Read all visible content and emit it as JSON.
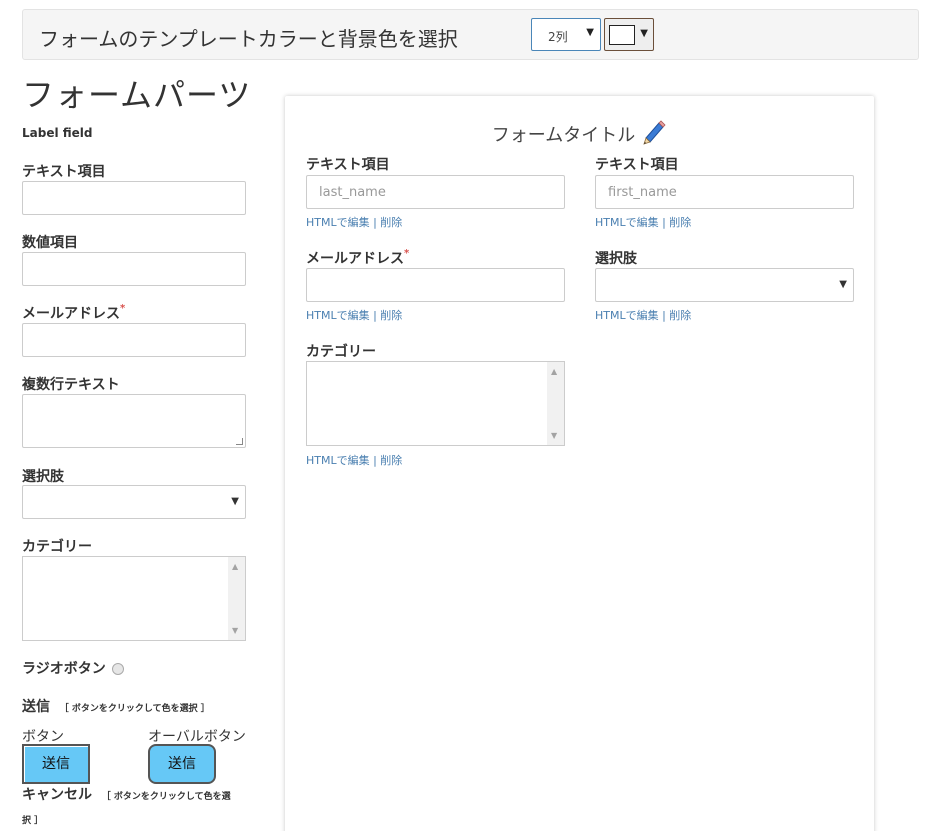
{
  "header": {
    "title": "フォームのテンプレートカラーと背景色を選択",
    "columns_select": "2列",
    "color_swatch": "#ffffff"
  },
  "palette": {
    "title": "フォームパーツ",
    "label_field": "Label field",
    "text_item": "テキスト項目",
    "number_item": "数値項目",
    "email_label": "メールアドレス",
    "required_mark": "*",
    "multiline_text": "複数行テキスト",
    "select_label": "選択肢",
    "category_label": "カテゴリー",
    "radio_label": "ラジオボタン",
    "submit_heading": "送信",
    "submit_hint": "［ ボタンをクリックして色を選択 ］",
    "button_caption": "ボタン",
    "oval_button_caption": "オーバルボタン",
    "submit_button": "送信",
    "oval_submit_button": "送信",
    "cancel_heading": "キャンセル",
    "cancel_hint": "［ ボタンをクリックして色を選",
    "cancel_hint_cont": "択 ］",
    "button_color": "#66c8f6"
  },
  "form": {
    "title": "フォームタイトル",
    "edit_icon": "pencil-icon",
    "fields": [
      {
        "label": "テキスト項目",
        "placeholder": "last_name",
        "links": "HTMLで編集 | 削除"
      },
      {
        "label": "テキスト項目",
        "placeholder": "first_name",
        "links": "HTMLで編集 | 削除"
      },
      {
        "label": "メールアドレス",
        "placeholder": "",
        "links": "HTMLで編集 | 削除"
      },
      {
        "label": "選択肢",
        "placeholder": "",
        "links": "HTMLで編集 | 削除"
      },
      {
        "label": "カテゴリー",
        "placeholder": "",
        "links": "HTMLで編集 | 削除"
      }
    ]
  }
}
